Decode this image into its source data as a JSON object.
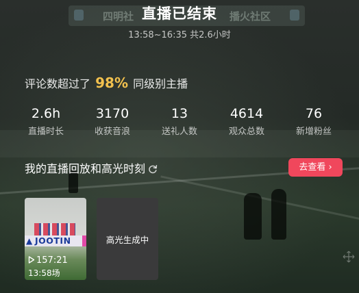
{
  "header": {
    "title": "直播已结束",
    "subtitle": "13:58~16:35 共2.6小时"
  },
  "background": {
    "banner_left": "四明社",
    "banner_right": "播火社区"
  },
  "comparison": {
    "prefix": "评论数超过了",
    "percent": "98%",
    "suffix": "同级别主播"
  },
  "stats": [
    {
      "value": "2.6h",
      "label": "直播时长"
    },
    {
      "value": "3170",
      "label": "收获音浪"
    },
    {
      "value": "13",
      "label": "送礼人数"
    },
    {
      "value": "4614",
      "label": "观众总数"
    },
    {
      "value": "76",
      "label": "新增粉丝"
    }
  ],
  "replay": {
    "title": "我的直播回放和高光时刻",
    "view_button": "去查看 ›",
    "video": {
      "brand": "JOOTIN",
      "duration": "157:21",
      "start": "13:58场"
    },
    "generating_label": "高光生成中"
  },
  "colors": {
    "accent_pink": "#f0475c",
    "highlight_gold": "#f2c14e"
  }
}
